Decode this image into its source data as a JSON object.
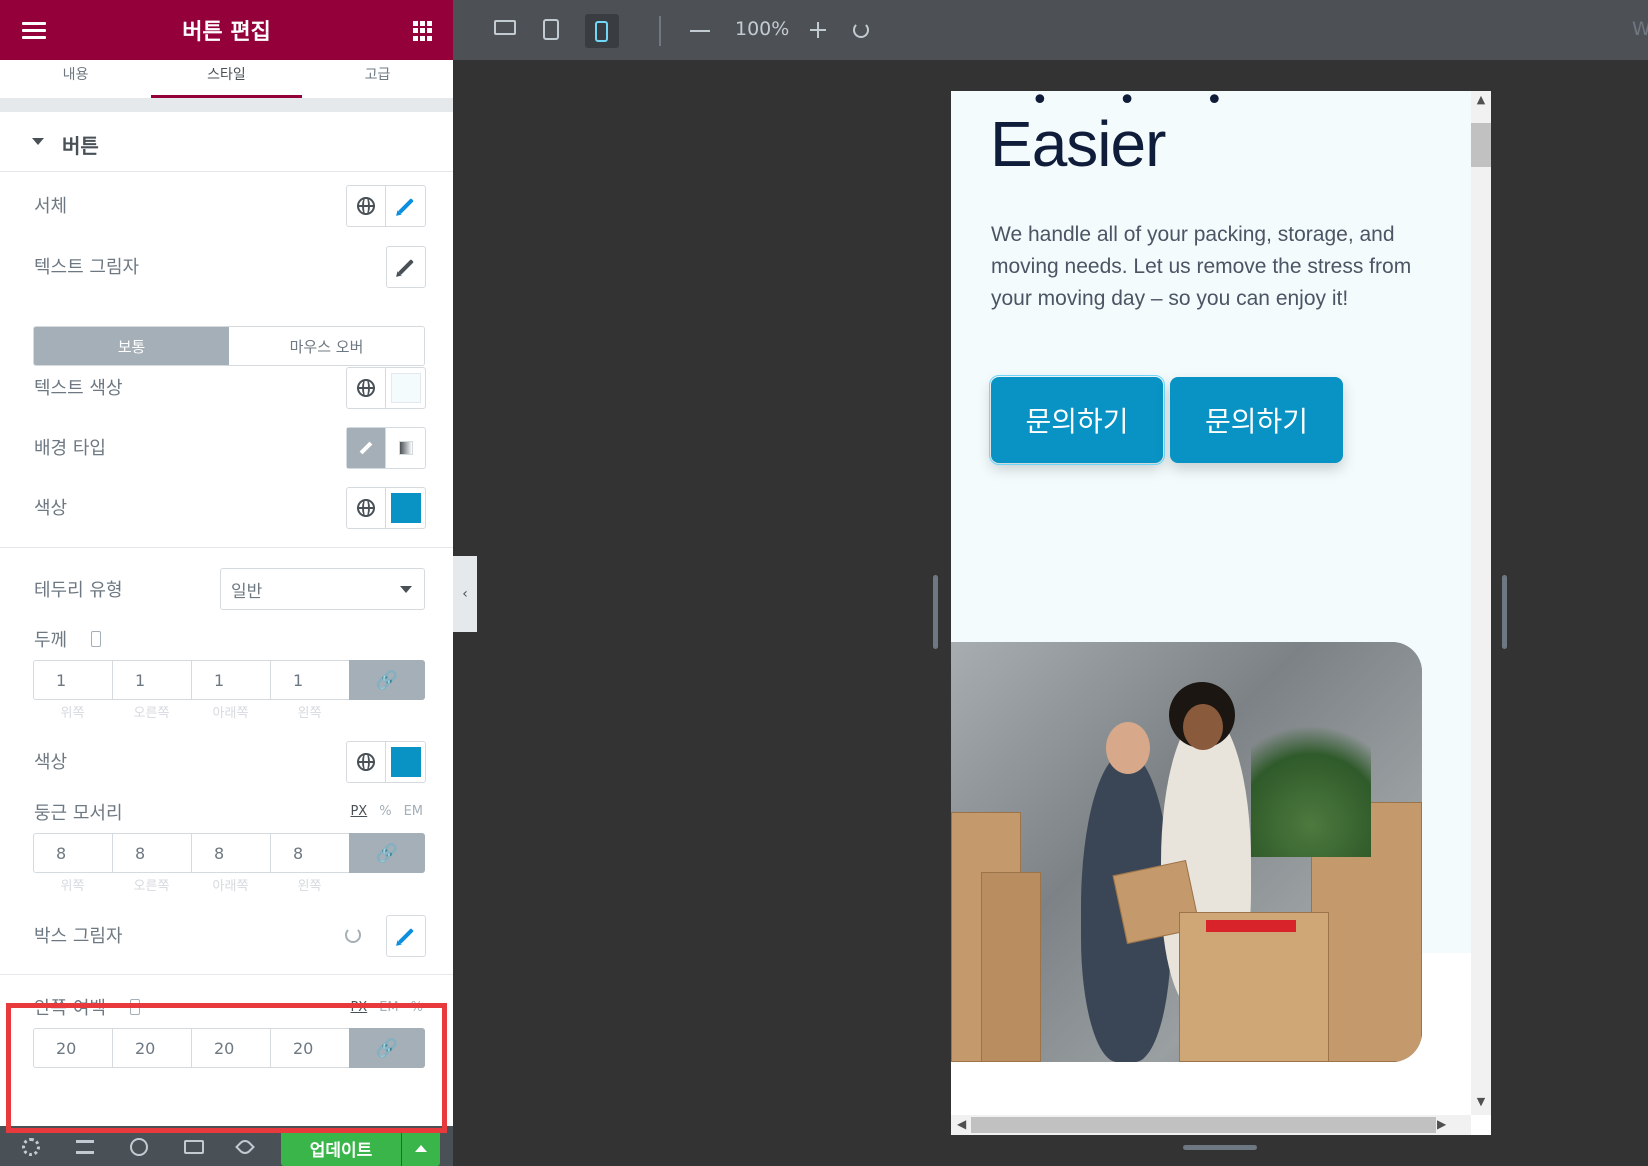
{
  "panel": {
    "title": "버튼 편집",
    "tabs": [
      "내용",
      "스타일",
      "고급"
    ],
    "section": "버튼",
    "typography_label": "서체",
    "text_shadow_label": "텍스트 그림자",
    "state_normal": "보통",
    "state_hover": "마우스 오버",
    "text_color_label": "텍스트 색상",
    "text_color": "#f3fbfd",
    "bg_type_label": "배경 타입",
    "color_label": "색상",
    "bg_color": "#0893c4",
    "border_type_label": "테두리 유형",
    "border_type_value": "일반",
    "width_label": "두께",
    "width_values": [
      "1",
      "1",
      "1",
      "1"
    ],
    "dim_labels": [
      "위쪽",
      "오른쪽",
      "아래쪽",
      "왼쪽"
    ],
    "border_color_label": "색상",
    "border_color": "#0893c4",
    "radius_label": "둥근 모서리",
    "radius_units": [
      "PX",
      "%",
      "EM"
    ],
    "radius_values": [
      "8",
      "8",
      "8",
      "8"
    ],
    "box_shadow_label": "박스 그림자",
    "padding_label": "안쪽 여백",
    "padding_units": [
      "PX",
      "EM",
      "%"
    ],
    "padding_values": [
      "20",
      "20",
      "20",
      "20"
    ]
  },
  "footer": {
    "update_label": "업데이트"
  },
  "toolbar": {
    "zoom": "100%",
    "corner": "W"
  },
  "preview": {
    "heading": "Easier",
    "paragraph": "We handle all of your packing, storage, and moving needs. Let us remove the stress from your moving day – so you can enjoy it!",
    "button1": "문의하기",
    "button2": "문의하기"
  },
  "colors": {
    "brand": "#93003a",
    "accent_blue": "#0893c4",
    "update_green": "#39b54a",
    "highlight_red": "#e8393c"
  }
}
